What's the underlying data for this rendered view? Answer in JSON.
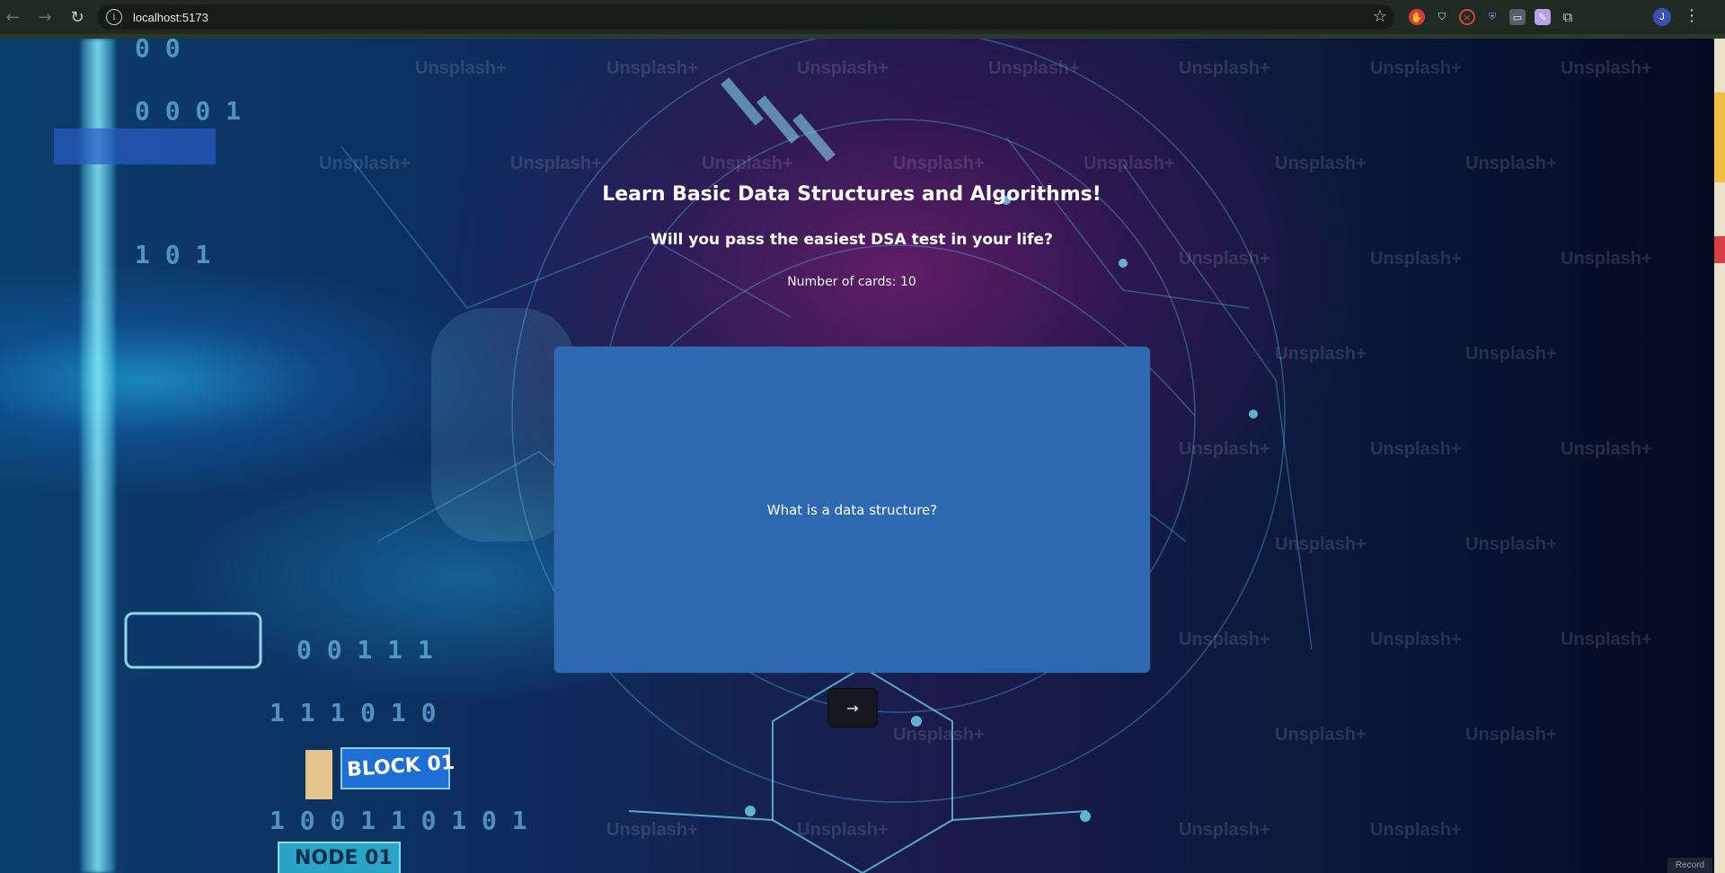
{
  "browser": {
    "url": "localhost:5173",
    "back_icon": "arrow-left-icon",
    "forward_icon": "arrow-right-icon",
    "reload_icon": "reload-icon",
    "bookmark_icon": "star-icon",
    "profile_initial": "J",
    "extensions": [
      {
        "name": "extension-red-hand-icon",
        "color": "#d93a3a"
      },
      {
        "name": "extension-shield-icon",
        "color": "#e6e6e6"
      },
      {
        "name": "extension-blocker-icon",
        "color": "#d04a3a"
      },
      {
        "name": "extension-badge-icon",
        "color": "#8a8fe6"
      },
      {
        "name": "extension-camera-icon",
        "color": "#9aa0a6"
      },
      {
        "name": "extension-pencil-icon",
        "color": "#b8a0e6"
      },
      {
        "name": "extensions-puzzle-icon",
        "color": "#c8cfc8"
      }
    ]
  },
  "app": {
    "title": "Learn Basic Data Structures and Algorithms!",
    "subtitle": "Will you pass the easiest DSA test in your life?",
    "card_count": "Number of cards: 10",
    "card_question": "What is a data structure?",
    "next_button": "→"
  },
  "background": {
    "watermark_text": "Unsplash+",
    "decor_labels": [
      "BLOCK 01",
      "NODE 01"
    ]
  },
  "overlay": {
    "record_label": "Record"
  },
  "colors": {
    "card": "#2d68b0",
    "button": "#15181e",
    "chrome": "#1f2a22"
  }
}
